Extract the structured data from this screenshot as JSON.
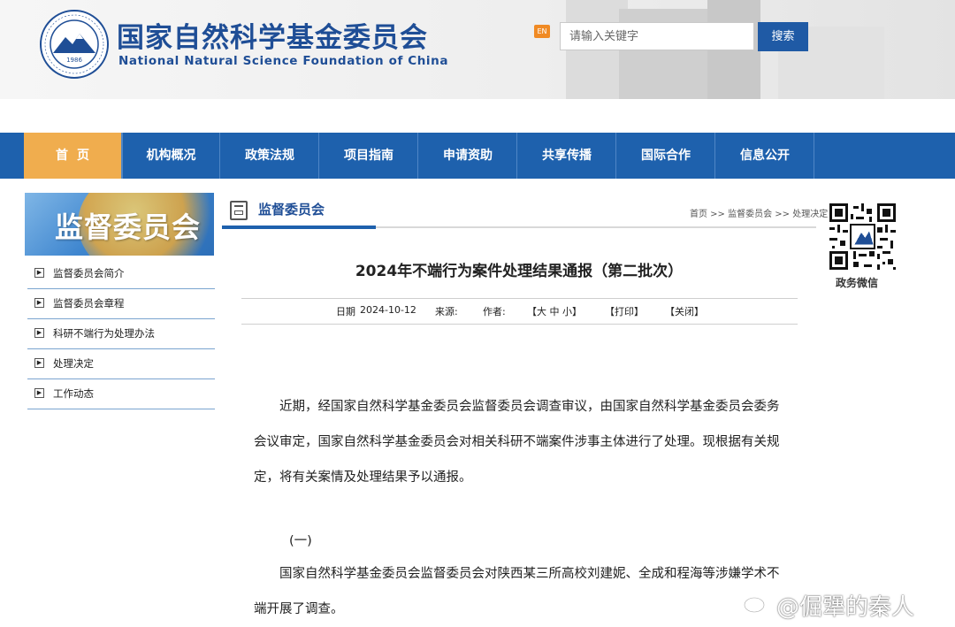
{
  "header": {
    "title_cn": "国家自然科学基金委员会",
    "title_en": "National Natural Science Foundation of China",
    "logo_year": "1986",
    "en_badge": "EN",
    "search_placeholder": "请输入关键字",
    "search_button": "搜索"
  },
  "nav": {
    "items": [
      {
        "label": "首页"
      },
      {
        "label": "机构概况"
      },
      {
        "label": "政策法规"
      },
      {
        "label": "项目指南"
      },
      {
        "label": "申请资助"
      },
      {
        "label": "共享传播"
      },
      {
        "label": "国际合作"
      },
      {
        "label": "信息公开"
      }
    ],
    "active_index": 0
  },
  "sidebar": {
    "banner_title": "监督委员会",
    "items": [
      {
        "label": "监督委员会简介"
      },
      {
        "label": "监督委员会章程"
      },
      {
        "label": "科研不端行为处理办法"
      },
      {
        "label": "处理决定"
      },
      {
        "label": "工作动态"
      }
    ]
  },
  "section": {
    "title": "监督委员会",
    "breadcrumb": "首页 >> 监督委员会 >> 处理决定"
  },
  "article": {
    "title": "2024年不端行为案件处理结果通报（第二批次）",
    "date_label": "日期",
    "date": "2024-10-12",
    "source_label": "来源:",
    "author_label": "作者:",
    "font_size_control": "【大 中 小】",
    "print": "【打印】",
    "close": "【关闭】",
    "paragraphs": [
      "近期，经国家自然科学基金委员会监督委员会调查审议，由国家自然科学基金委员会委务会议审定，国家自然科学基金委员会对相关科研不端案件涉事主体进行了处理。现根据有关规定，将有关案情及处理结果予以通报。",
      "国家自然科学基金委员会监督委员会对陕西某三所高校刘建妮、全成和程海等涉嫌学术不端开展了调查。"
    ],
    "section_heading": "(一)"
  },
  "qr": {
    "label": "政务微信"
  },
  "watermark": {
    "text": "@倔犟的秦人"
  },
  "colors": {
    "brand_blue": "#1e61ad",
    "nav_active": "#f0ad4e",
    "title_blue": "#1f4e96"
  }
}
